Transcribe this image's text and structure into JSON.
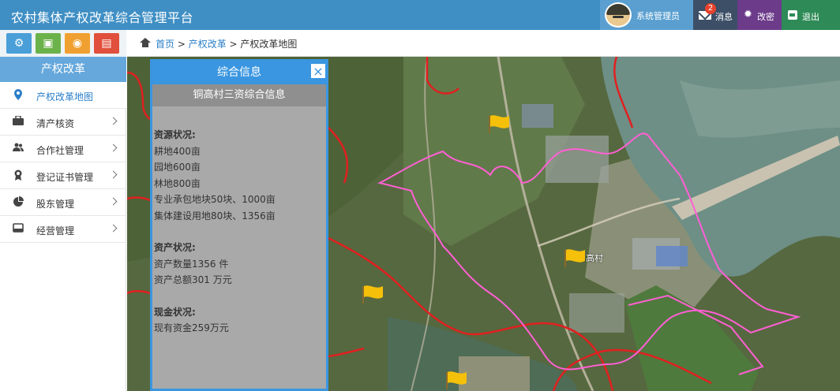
{
  "header": {
    "app_title": "农村集体产权改革综合管理平台",
    "user_name": "系统管理员",
    "msg_label": "消息",
    "msg_count": "2",
    "pwd_label": "改密",
    "exit_label": "退出"
  },
  "quick_buttons": [
    {
      "icon": "settings-icon",
      "color": "#4a9fd8",
      "glyph": "⚙"
    },
    {
      "icon": "image-icon",
      "color": "#6cb24a",
      "glyph": "▣"
    },
    {
      "icon": "camera-icon",
      "color": "#f0a030",
      "glyph": "◉"
    },
    {
      "icon": "monitor-icon",
      "color": "#e0503c",
      "glyph": "▤"
    }
  ],
  "sidebar": {
    "title": "产权改革",
    "items": [
      {
        "label": "产权改革地图",
        "icon": "location-pin-icon",
        "glyph": "⬤",
        "active": true
      },
      {
        "label": "清产核资",
        "icon": "briefcase-icon",
        "glyph": "▬",
        "active": false
      },
      {
        "label": "合作社管理",
        "icon": "users-icon",
        "glyph": "☺",
        "active": false
      },
      {
        "label": "登记证书管理",
        "icon": "certificate-icon",
        "glyph": "✪",
        "active": false
      },
      {
        "label": "股东管理",
        "icon": "pie-chart-icon",
        "glyph": "◕",
        "active": false
      },
      {
        "label": "经营管理",
        "icon": "drive-icon",
        "glyph": "▭",
        "active": false
      }
    ]
  },
  "breadcrumb": {
    "home": "首页",
    "section": "产权改革",
    "current": "产权改革地图",
    "sep": " > "
  },
  "info_panel": {
    "title": "综合信息",
    "close": "×",
    "subtitle": "铜高村三资综合信息",
    "resources_title": "资源状况:",
    "resources": [
      "耕地400亩",
      "园地600亩",
      "林地800亩",
      "专业承包地块50块、1000亩",
      "集体建设用地80块、1356亩"
    ],
    "assets_title": "资产状况:",
    "assets": [
      "资产数量1356 件",
      "资产总额301 万元"
    ],
    "cash_title": "现金状况:",
    "cash": [
      "现有资金259万元"
    ]
  },
  "map": {
    "village_label": "高村"
  }
}
